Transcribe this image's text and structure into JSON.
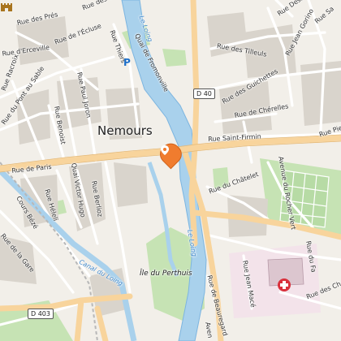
{
  "map": {
    "town_label": "Nemours",
    "island_label": "Île du Perthuis",
    "water_labels": {
      "loing_north": "Le Loing",
      "loing_south": "Le Loing",
      "canal": "Canal du Loing"
    },
    "road_shields": {
      "d40": "D 40",
      "d403": "D 403"
    },
    "streets": {
      "rue_de_paris": "Rue de Paris",
      "rue_saint_firmin": "Rue Saint-Firmin",
      "rue_de_l_ecluse": "Rue de l'Écluse",
      "quai_de_fromonville": "Quai de Fromonville",
      "rue_thiers": "Rue Thiers",
      "rue_des_tilleuls": "Rue des Tilleuls",
      "rue_des_guichettes": "Rue des Guichettes",
      "rue_de_cherelles": "Rue de Chérelles",
      "avenue_rocher_vert": "Avenue du Rocher Vert",
      "rue_du_chatelet": "Rue du Châtelet",
      "quai_victor_hugo": "Quai Victor Hugo",
      "cours_beze": "Cours Bézé",
      "rue_heleli": "Rue Héleli",
      "rue_de_la_gare": "Rue de la Gare",
      "rue_benoist": "Rue Benoist",
      "rue_paul_joron": "Rue Paul Joron",
      "rue_du_pont_au_sable": "Rue du Pont au Sable",
      "rue_de_beauregard": "Rue de Beauregard",
      "rue_jean_mace": "Rue Jean Macé",
      "rue_jean_gorino": "Rue Jean Gorino",
      "rue_desse": "Rue Desse",
      "rue_pierre": "Rue Pierre",
      "rue_d_erceville": "Rue d'Erceville",
      "rue_berlioz": "Rue Berlioz",
      "rue_racroix": "Rue Racroix",
      "avenue_truncated": "Aven",
      "rue_des_pres": "Rue des Prés",
      "rue_des_ch": "Rue des Ch",
      "rue_sa": "Rue Sa",
      "rue_des_ca": "Rue des Ca",
      "rue_du_faubourg": "Rue du Fa"
    },
    "icons": [
      "parking-icon",
      "location-pin-icon",
      "castle-icon",
      "hospital-icon"
    ],
    "colors": {
      "land": "#f2efe9",
      "water": "#a9d1ec",
      "river_bank": "#7cb5e0",
      "main_road": "#f8d49c",
      "park": "#c6e3b4",
      "pin": "#f07c2e",
      "hospital": "#d9303b"
    }
  }
}
